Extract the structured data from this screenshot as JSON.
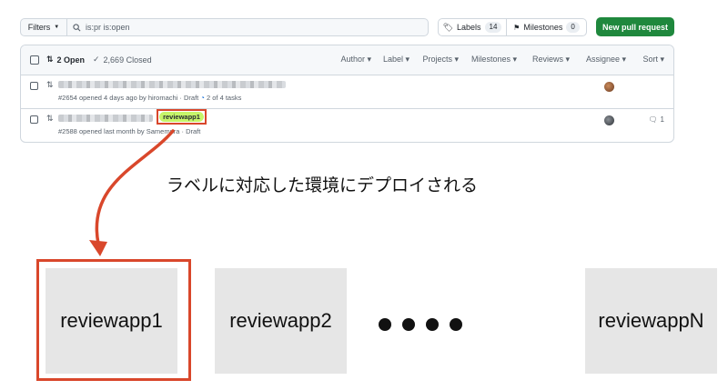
{
  "toolbar": {
    "filters_label": "Filters",
    "search_value": "is:pr is:open",
    "labels_label": "Labels",
    "labels_count": "14",
    "milestones_label": "Milestones",
    "milestones_count": "0",
    "new_pr_label": "New pull request"
  },
  "list_header": {
    "open_label": "2 Open",
    "closed_label": "2,669 Closed",
    "filters": [
      "Author",
      "Label",
      "Projects",
      "Milestones",
      "Reviews",
      "Assignee",
      "Sort"
    ]
  },
  "rows": [
    {
      "meta": "#2654 opened 4 days ago by hiromachi · Draft",
      "tasks": "2 of 4 tasks"
    },
    {
      "meta": "#2588 opened last month by Samemura · Draft",
      "label": "reviewapp1",
      "comments": "1"
    }
  ],
  "caption": "ラベルに対応した環境にデプロイされる",
  "environments": {
    "first": "reviewapp1",
    "second": "reviewapp2",
    "last": "reviewappN"
  },
  "colors": {
    "accent": "#d9472b",
    "label_bg": "#c6f56a",
    "primary_button": "#1f883d",
    "env_box": "#e6e6e6"
  }
}
